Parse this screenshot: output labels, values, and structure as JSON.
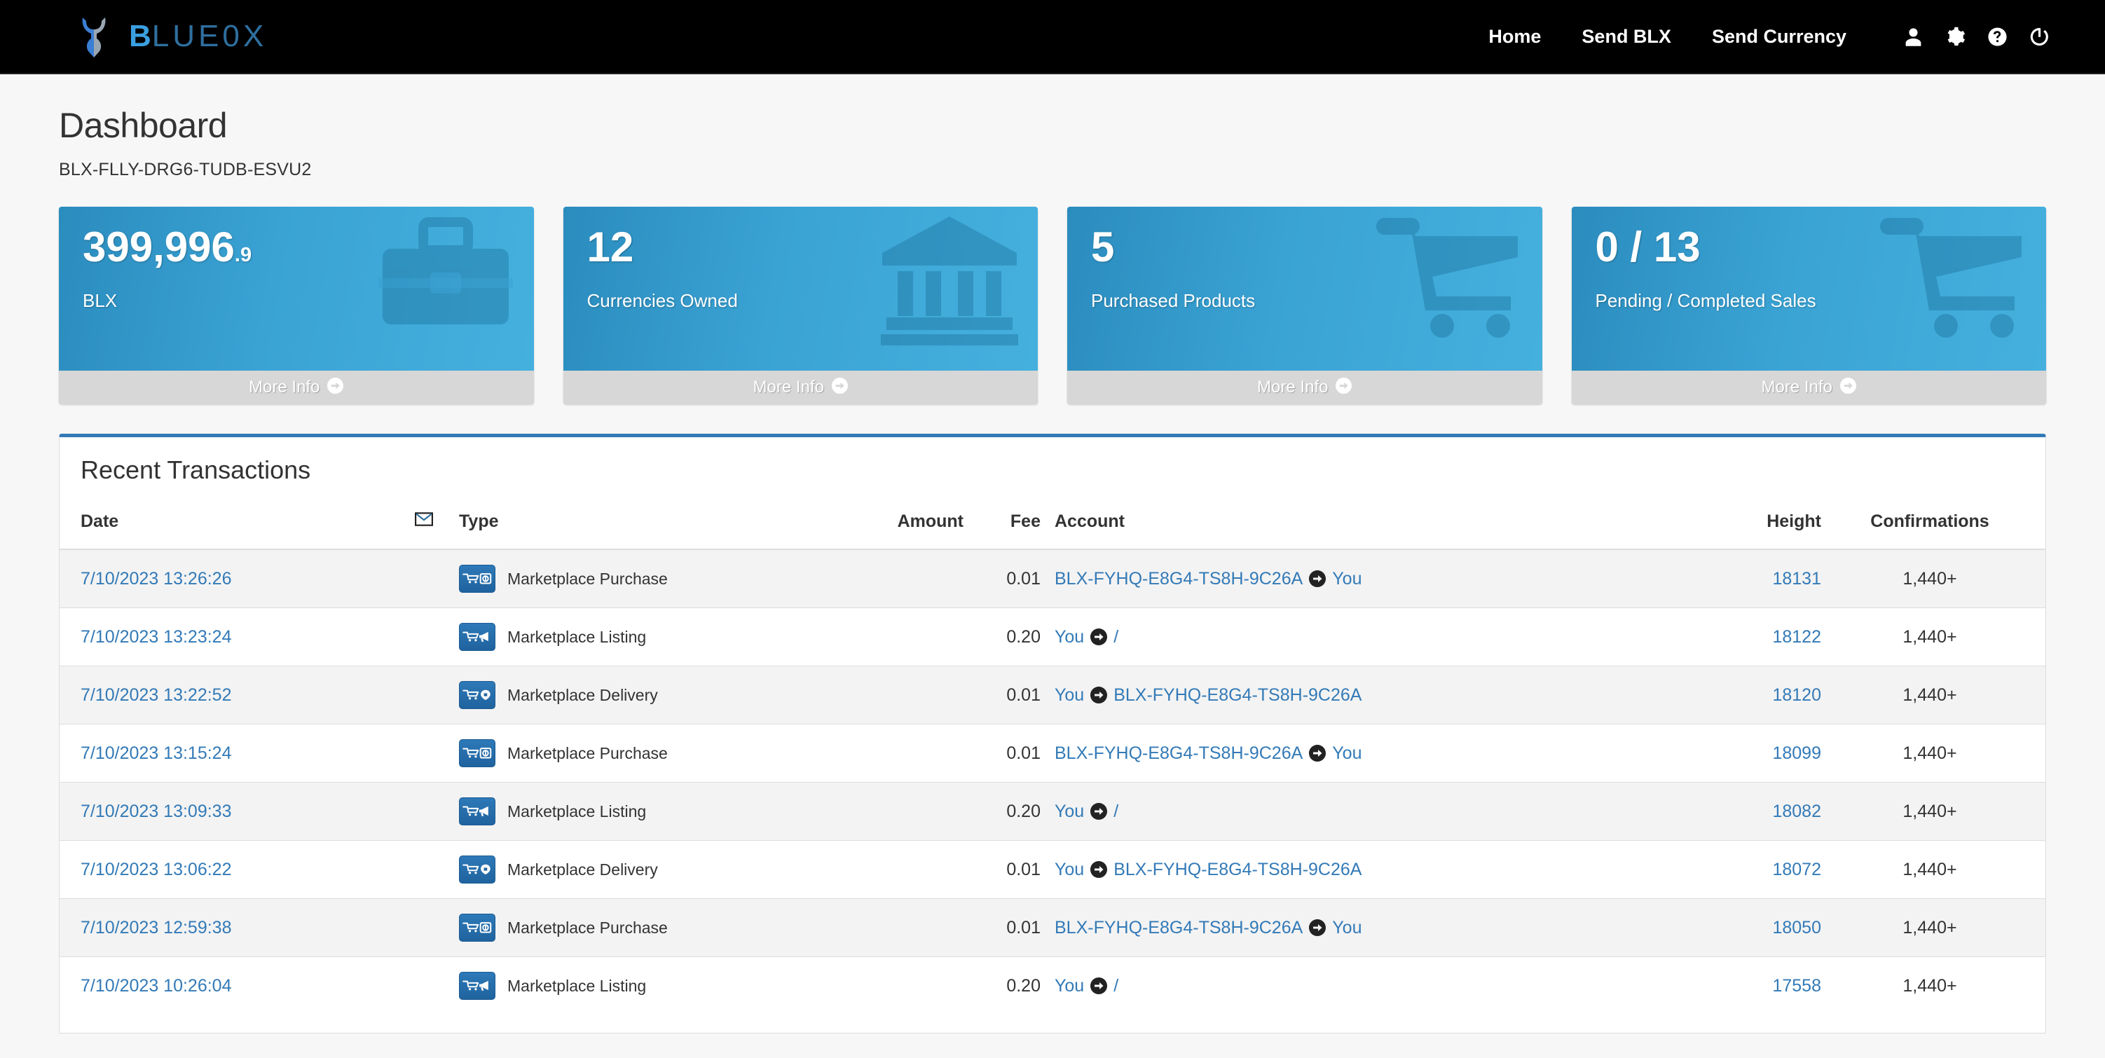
{
  "navbar": {
    "brand": {
      "prefix": "B",
      "rest": "LUE0X",
      "logo_icon": "bull-head-logo"
    },
    "links": [
      {
        "label": "Home",
        "name": "nav-link-home"
      },
      {
        "label": "Send BLX",
        "name": "nav-link-send-blx"
      },
      {
        "label": "Send Currency",
        "name": "nav-link-send-currency"
      }
    ],
    "icons": [
      {
        "name": "user-icon"
      },
      {
        "name": "gear-icon"
      },
      {
        "name": "help-circle-icon"
      },
      {
        "name": "power-icon"
      }
    ]
  },
  "page": {
    "title": "Dashboard",
    "address": "BLX-FLLY-DRG6-TUDB-ESVU2"
  },
  "cards": [
    {
      "value": "399,996",
      "fraction": ".9",
      "label": "BLX",
      "icon": "briefcase-icon",
      "footer": "More Info",
      "name": "stat-card-blx-balance"
    },
    {
      "value": "12",
      "fraction": "",
      "label": "Currencies Owned",
      "icon": "bank-icon",
      "footer": "More Info",
      "name": "stat-card-currencies-owned"
    },
    {
      "value": "5",
      "fraction": "",
      "label": "Purchased Products",
      "icon": "shopping-cart-icon",
      "footer": "More Info",
      "name": "stat-card-purchased-products"
    },
    {
      "value": "0 / 13",
      "fraction": "",
      "label": "Pending / Completed Sales",
      "icon": "shopping-cart-icon",
      "footer": "More Info",
      "name": "stat-card-pending-completed-sales"
    }
  ],
  "transactions_panel": {
    "title": "Recent Transactions",
    "columns": {
      "date": "Date",
      "flag": "envelope-icon",
      "type": "Type",
      "amount": "Amount",
      "fee": "Fee",
      "account": "Account",
      "height": "Height",
      "confirmations": "Confirmations"
    },
    "rows": [
      {
        "date": "7/10/2023 13:26:26",
        "type_icon": "cart-coin-icon",
        "type": "Marketplace Purchase",
        "amount": "",
        "fee": "0.01",
        "fee_color": "dark",
        "account_from": "BLX-FYHQ-E8G4-TS8H-9C26A",
        "account_to": "You",
        "height": "18131",
        "confirmations": "1,440+"
      },
      {
        "date": "7/10/2023 13:23:24",
        "type_icon": "cart-megaphone-icon",
        "type": "Marketplace Listing",
        "amount": "",
        "fee": "0.20",
        "fee_color": "red",
        "account_from": "You",
        "account_to": "/",
        "height": "18122",
        "confirmations": "1,440+"
      },
      {
        "date": "7/10/2023 13:22:52",
        "type_icon": "cart-box-icon",
        "type": "Marketplace Delivery",
        "amount": "",
        "fee": "0.01",
        "fee_color": "red",
        "account_from": "You",
        "account_to": "BLX-FYHQ-E8G4-TS8H-9C26A",
        "height": "18120",
        "confirmations": "1,440+"
      },
      {
        "date": "7/10/2023 13:15:24",
        "type_icon": "cart-coin-icon",
        "type": "Marketplace Purchase",
        "amount": "",
        "fee": "0.01",
        "fee_color": "dark",
        "account_from": "BLX-FYHQ-E8G4-TS8H-9C26A",
        "account_to": "You",
        "height": "18099",
        "confirmations": "1,440+"
      },
      {
        "date": "7/10/2023 13:09:33",
        "type_icon": "cart-megaphone-icon",
        "type": "Marketplace Listing",
        "amount": "",
        "fee": "0.20",
        "fee_color": "red",
        "account_from": "You",
        "account_to": "/",
        "height": "18082",
        "confirmations": "1,440+"
      },
      {
        "date": "7/10/2023 13:06:22",
        "type_icon": "cart-box-icon",
        "type": "Marketplace Delivery",
        "amount": "",
        "fee": "0.01",
        "fee_color": "red",
        "account_from": "You",
        "account_to": "BLX-FYHQ-E8G4-TS8H-9C26A",
        "height": "18072",
        "confirmations": "1,440+"
      },
      {
        "date": "7/10/2023 12:59:38",
        "type_icon": "cart-coin-icon",
        "type": "Marketplace Purchase",
        "amount": "",
        "fee": "0.01",
        "fee_color": "dark",
        "account_from": "BLX-FYHQ-E8G4-TS8H-9C26A",
        "account_to": "You",
        "height": "18050",
        "confirmations": "1,440+"
      },
      {
        "date": "7/10/2023 10:26:04",
        "type_icon": "cart-megaphone-icon",
        "type": "Marketplace Listing",
        "amount": "",
        "fee": "0.20",
        "fee_color": "red",
        "account_from": "You",
        "account_to": "/",
        "height": "17558",
        "confirmations": "1,440+"
      }
    ]
  },
  "colors": {
    "navbar_bg": "#000000",
    "brand_accent": "#3a9fe0",
    "card_gradient_start": "#2b8cbe",
    "card_gradient_end": "#45b0de",
    "panel_accent": "#337ab7",
    "link": "#337ab7",
    "fee_red": "#ff0000"
  }
}
